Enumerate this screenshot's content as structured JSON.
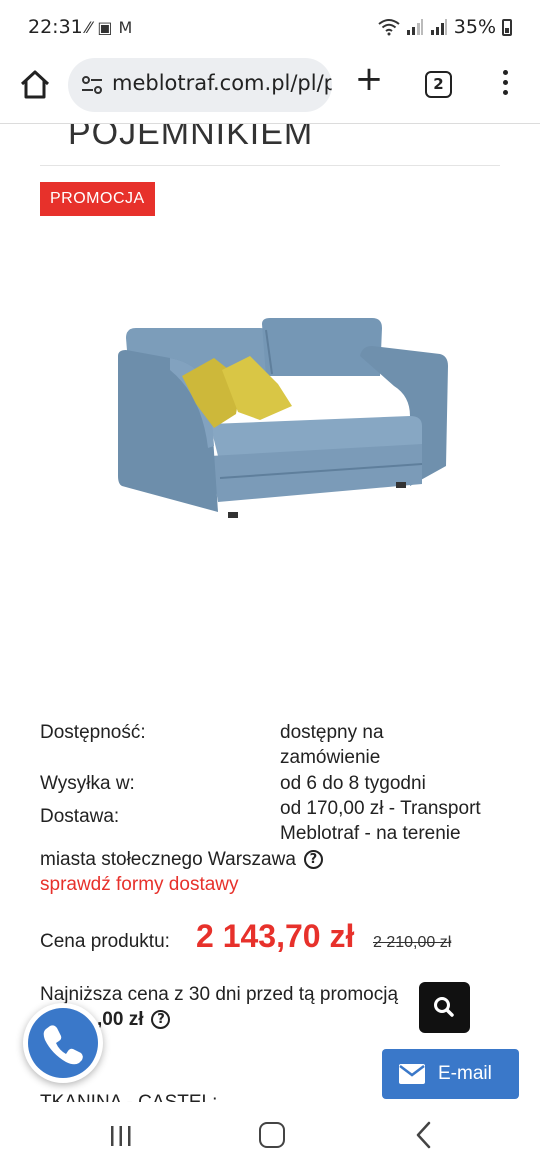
{
  "status_bar": {
    "time": "22:31",
    "left_icons": [
      "bluetooth-activity-icon",
      "gallery-icon",
      "gmail-icon"
    ],
    "battery": "35%",
    "right_icons": [
      "wifi-icon",
      "signal-icon",
      "signal-icon",
      "battery-icon"
    ]
  },
  "browser": {
    "url": "meblotraf.com.pl/pl/p",
    "tab_count": "2",
    "new_tab_icon": "plus-icon",
    "home_icon": "home-icon",
    "menu_icon": "more-vert-icon",
    "site_info_icon": "tune-icon"
  },
  "product": {
    "title_partial": "POJEMNIKIEM",
    "promo_badge": "PROMOCJA",
    "image_description_icon": "sofa-image",
    "colors": {
      "accent_red": "#e7312b",
      "sofa_blue": "#7a9bb8",
      "pillow_yellow": "#d6c13a",
      "button_blue": "#3a78c9"
    }
  },
  "details": {
    "availability_label": "Dostępność:",
    "availability_value_line1": "dostępny na",
    "availability_value_line2": "zamówienie",
    "shipping_label": "Wysyłka w:",
    "shipping_value": "od 6 do 8 tygodni",
    "delivery_label": "Dostawa:",
    "delivery_value_line1": "od 170,00 zł - Transport",
    "delivery_value_line2": "Meblotraf - na terenie",
    "delivery_value_line3": "miasta stołecznego Warszawa",
    "delivery_link": "sprawdź formy dostawy"
  },
  "pricing": {
    "price_label": "Cena produktu:",
    "price": "2 143,70 zł",
    "old_price": "2 210,00 zł",
    "lowest_label": "Najniższa cena z 30 dni przed tą promocją",
    "lowest_value": ",00 zł"
  },
  "fabric": {
    "label": "TKANINA - CASTEL:"
  },
  "floating": {
    "email_label": "E-mail",
    "search_icon": "search-icon",
    "phone_icon": "phone-icon",
    "email_icon": "envelope-icon"
  },
  "nav": {
    "recent_icon": "recent-apps-icon",
    "home_icon": "home-circle-icon",
    "back_icon": "back-icon"
  }
}
